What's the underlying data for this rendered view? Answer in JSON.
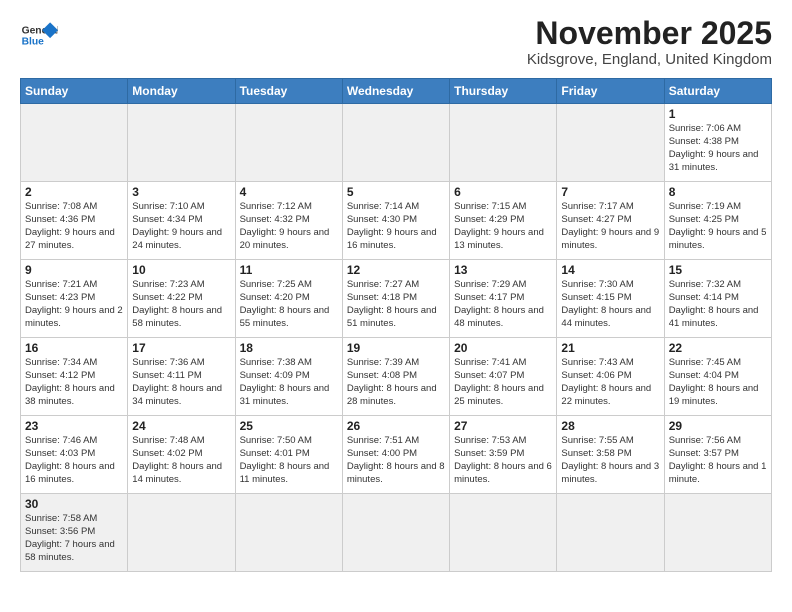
{
  "logo": {
    "general": "General",
    "blue": "Blue"
  },
  "header": {
    "title": "November 2025",
    "subtitle": "Kidsgrove, England, United Kingdom"
  },
  "weekdays": [
    "Sunday",
    "Monday",
    "Tuesday",
    "Wednesday",
    "Thursday",
    "Friday",
    "Saturday"
  ],
  "weeks": [
    [
      {
        "day": "",
        "info": ""
      },
      {
        "day": "",
        "info": ""
      },
      {
        "day": "",
        "info": ""
      },
      {
        "day": "",
        "info": ""
      },
      {
        "day": "",
        "info": ""
      },
      {
        "day": "",
        "info": ""
      },
      {
        "day": "1",
        "info": "Sunrise: 7:06 AM\nSunset: 4:38 PM\nDaylight: 9 hours\nand 31 minutes."
      }
    ],
    [
      {
        "day": "2",
        "info": "Sunrise: 7:08 AM\nSunset: 4:36 PM\nDaylight: 9 hours\nand 27 minutes."
      },
      {
        "day": "3",
        "info": "Sunrise: 7:10 AM\nSunset: 4:34 PM\nDaylight: 9 hours\nand 24 minutes."
      },
      {
        "day": "4",
        "info": "Sunrise: 7:12 AM\nSunset: 4:32 PM\nDaylight: 9 hours\nand 20 minutes."
      },
      {
        "day": "5",
        "info": "Sunrise: 7:14 AM\nSunset: 4:30 PM\nDaylight: 9 hours\nand 16 minutes."
      },
      {
        "day": "6",
        "info": "Sunrise: 7:15 AM\nSunset: 4:29 PM\nDaylight: 9 hours\nand 13 minutes."
      },
      {
        "day": "7",
        "info": "Sunrise: 7:17 AM\nSunset: 4:27 PM\nDaylight: 9 hours\nand 9 minutes."
      },
      {
        "day": "8",
        "info": "Sunrise: 7:19 AM\nSunset: 4:25 PM\nDaylight: 9 hours\nand 5 minutes."
      }
    ],
    [
      {
        "day": "9",
        "info": "Sunrise: 7:21 AM\nSunset: 4:23 PM\nDaylight: 9 hours\nand 2 minutes."
      },
      {
        "day": "10",
        "info": "Sunrise: 7:23 AM\nSunset: 4:22 PM\nDaylight: 8 hours\nand 58 minutes."
      },
      {
        "day": "11",
        "info": "Sunrise: 7:25 AM\nSunset: 4:20 PM\nDaylight: 8 hours\nand 55 minutes."
      },
      {
        "day": "12",
        "info": "Sunrise: 7:27 AM\nSunset: 4:18 PM\nDaylight: 8 hours\nand 51 minutes."
      },
      {
        "day": "13",
        "info": "Sunrise: 7:29 AM\nSunset: 4:17 PM\nDaylight: 8 hours\nand 48 minutes."
      },
      {
        "day": "14",
        "info": "Sunrise: 7:30 AM\nSunset: 4:15 PM\nDaylight: 8 hours\nand 44 minutes."
      },
      {
        "day": "15",
        "info": "Sunrise: 7:32 AM\nSunset: 4:14 PM\nDaylight: 8 hours\nand 41 minutes."
      }
    ],
    [
      {
        "day": "16",
        "info": "Sunrise: 7:34 AM\nSunset: 4:12 PM\nDaylight: 8 hours\nand 38 minutes."
      },
      {
        "day": "17",
        "info": "Sunrise: 7:36 AM\nSunset: 4:11 PM\nDaylight: 8 hours\nand 34 minutes."
      },
      {
        "day": "18",
        "info": "Sunrise: 7:38 AM\nSunset: 4:09 PM\nDaylight: 8 hours\nand 31 minutes."
      },
      {
        "day": "19",
        "info": "Sunrise: 7:39 AM\nSunset: 4:08 PM\nDaylight: 8 hours\nand 28 minutes."
      },
      {
        "day": "20",
        "info": "Sunrise: 7:41 AM\nSunset: 4:07 PM\nDaylight: 8 hours\nand 25 minutes."
      },
      {
        "day": "21",
        "info": "Sunrise: 7:43 AM\nSunset: 4:06 PM\nDaylight: 8 hours\nand 22 minutes."
      },
      {
        "day": "22",
        "info": "Sunrise: 7:45 AM\nSunset: 4:04 PM\nDaylight: 8 hours\nand 19 minutes."
      }
    ],
    [
      {
        "day": "23",
        "info": "Sunrise: 7:46 AM\nSunset: 4:03 PM\nDaylight: 8 hours\nand 16 minutes."
      },
      {
        "day": "24",
        "info": "Sunrise: 7:48 AM\nSunset: 4:02 PM\nDaylight: 8 hours\nand 14 minutes."
      },
      {
        "day": "25",
        "info": "Sunrise: 7:50 AM\nSunset: 4:01 PM\nDaylight: 8 hours\nand 11 minutes."
      },
      {
        "day": "26",
        "info": "Sunrise: 7:51 AM\nSunset: 4:00 PM\nDaylight: 8 hours\nand 8 minutes."
      },
      {
        "day": "27",
        "info": "Sunrise: 7:53 AM\nSunset: 3:59 PM\nDaylight: 8 hours\nand 6 minutes."
      },
      {
        "day": "28",
        "info": "Sunrise: 7:55 AM\nSunset: 3:58 PM\nDaylight: 8 hours\nand 3 minutes."
      },
      {
        "day": "29",
        "info": "Sunrise: 7:56 AM\nSunset: 3:57 PM\nDaylight: 8 hours\nand 1 minute."
      }
    ],
    [
      {
        "day": "30",
        "info": "Sunrise: 7:58 AM\nSunset: 3:56 PM\nDaylight: 7 hours\nand 58 minutes."
      },
      {
        "day": "",
        "info": ""
      },
      {
        "day": "",
        "info": ""
      },
      {
        "day": "",
        "info": ""
      },
      {
        "day": "",
        "info": ""
      },
      {
        "day": "",
        "info": ""
      },
      {
        "day": "",
        "info": ""
      }
    ]
  ]
}
